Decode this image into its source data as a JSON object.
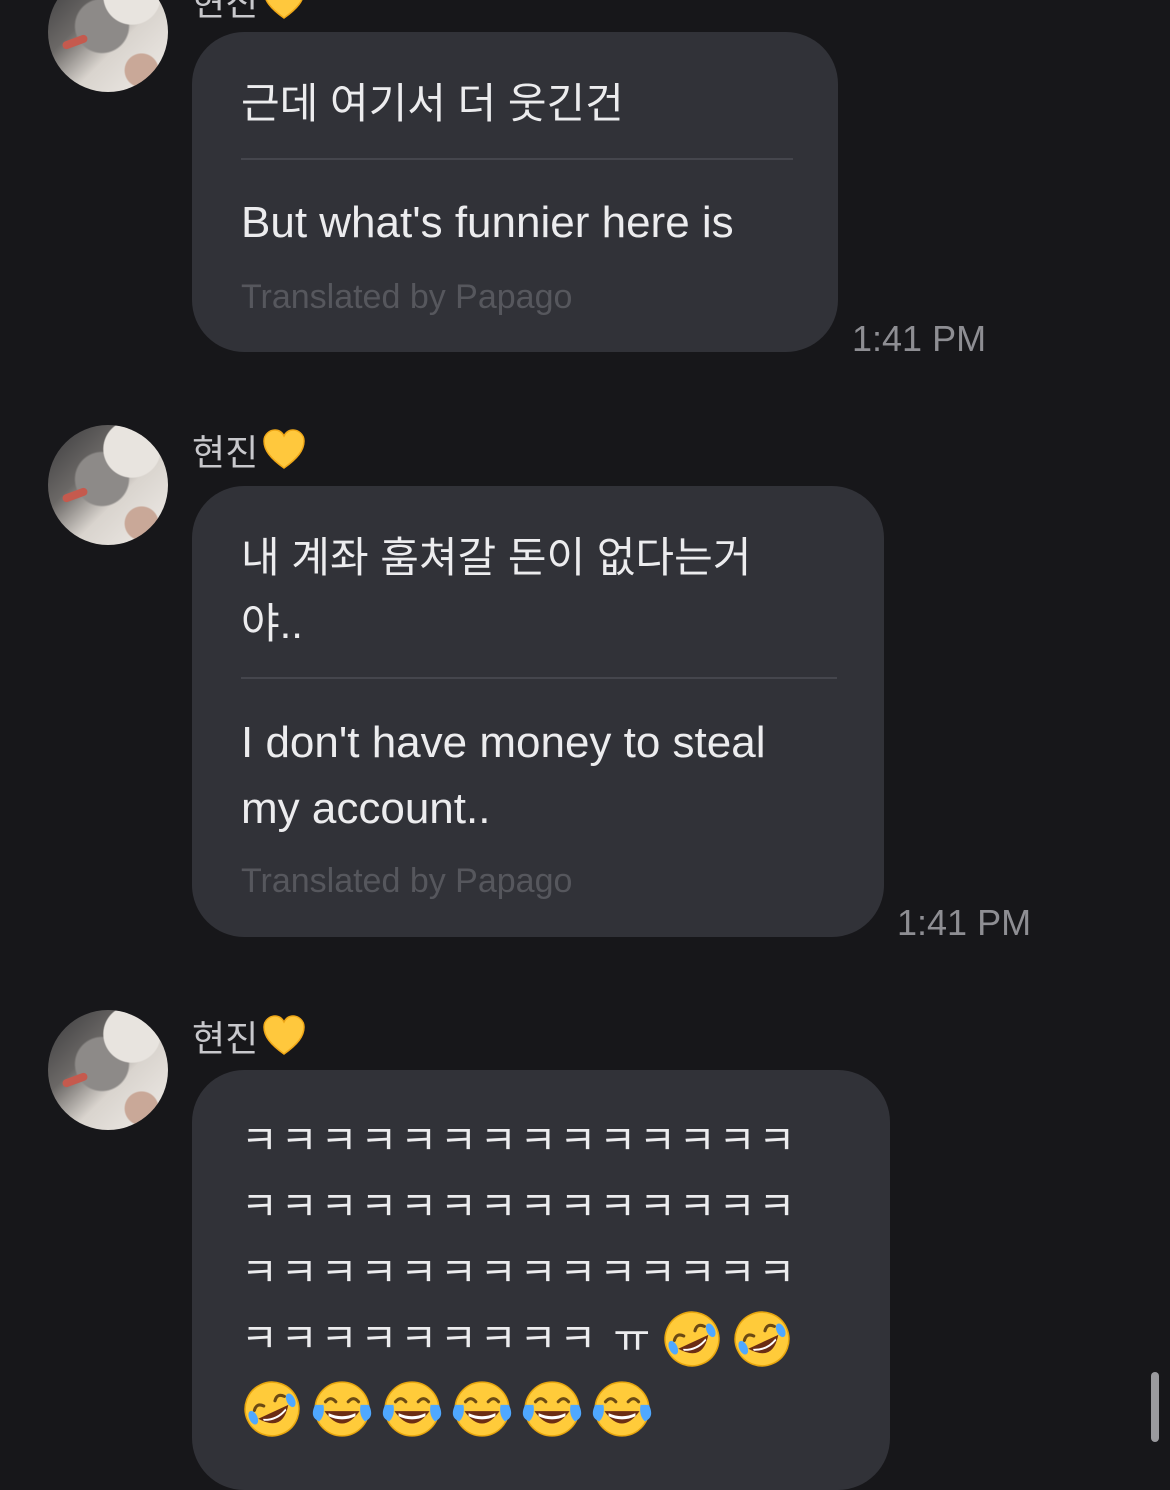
{
  "messages": [
    {
      "sender": "현진",
      "original": "근데 여기서 더 웃긴건",
      "translation": "But what's funnier here is",
      "credit": "Translated by Papago",
      "time": "1:41 PM"
    },
    {
      "sender": "현진",
      "original_lines": [
        "내 계좌 훔쳐갈 돈이 없다는거",
        "야.."
      ],
      "translation_lines": [
        "I don't have money to steal",
        "my account.."
      ],
      "credit": "Translated by Papago",
      "time": "1:41 PM"
    },
    {
      "sender": "현진",
      "lines": [
        "ㅋㅋㅋㅋㅋㅋㅋㅋㅋㅋㅋㅋㅋㅋ",
        "ㅋㅋㅋㅋㅋㅋㅋㅋㅋㅋㅋㅋㅋㅋ",
        "ㅋㅋㅋㅋㅋㅋㅋㅋㅋㅋㅋㅋㅋㅋ",
        "ㅋㅋㅋㅋㅋㅋㅋㅋㅋ ㅠ"
      ],
      "emoji_line1": [
        "rolling-on-floor-laughing",
        "rolling-on-floor-laughing"
      ],
      "emoji_line2": [
        "rolling-on-floor-laughing",
        "tears-of-joy",
        "tears-of-joy",
        "tears-of-joy",
        "tears-of-joy",
        "tears-of-joy"
      ]
    }
  ],
  "colors": {
    "background": "#17171a",
    "bubble": "#313238",
    "heart": "#ffc83d",
    "credit_text": "#56575d",
    "timestamp": "#8e8e93"
  },
  "icons": {
    "heart": "yellow-heart-icon",
    "avatar": "profile-photo"
  }
}
